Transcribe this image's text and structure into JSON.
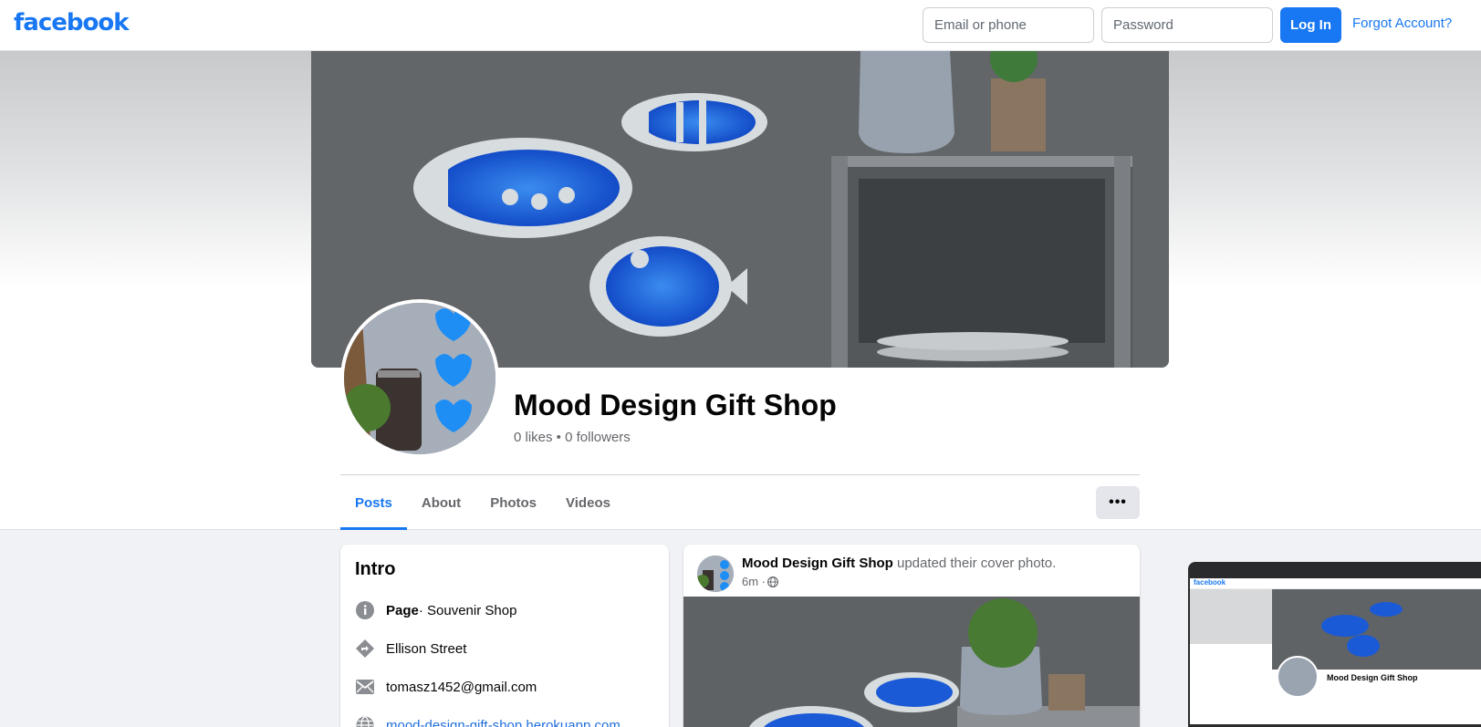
{
  "topbar": {
    "logo": "facebook",
    "email_placeholder": "Email or phone",
    "password_placeholder": "Password",
    "login_label": "Log In",
    "forgot_label": "Forgot Account?"
  },
  "page": {
    "name": "Mood Design Gift Shop",
    "stats": "0 likes • 0 followers"
  },
  "tabs": [
    {
      "label": "Posts",
      "active": true
    },
    {
      "label": "About",
      "active": false
    },
    {
      "label": "Photos",
      "active": false
    },
    {
      "label": "Videos",
      "active": false
    }
  ],
  "more_label": "•••",
  "intro": {
    "title": "Intro",
    "category_prefix": "Page",
    "category": " · Souvenir Shop",
    "address": "Ellison Street",
    "email": "tomasz1452@gmail.com",
    "website": "mood-design-gift-shop.herokuapp.com"
  },
  "post": {
    "author": "Mood Design Gift Shop",
    "action": " updated their cover photo.",
    "time": "6m · "
  },
  "thumb": {
    "logo": "facebook",
    "name": "Mood Design Gift Shop"
  },
  "colors": {
    "brand": "#1877f2",
    "background": "#f0f2f5",
    "secondary_text": "#65676b"
  },
  "icons": [
    "info-icon",
    "directions-icon",
    "email-icon",
    "globe-icon",
    "globe-small-icon",
    "more-icon"
  ]
}
